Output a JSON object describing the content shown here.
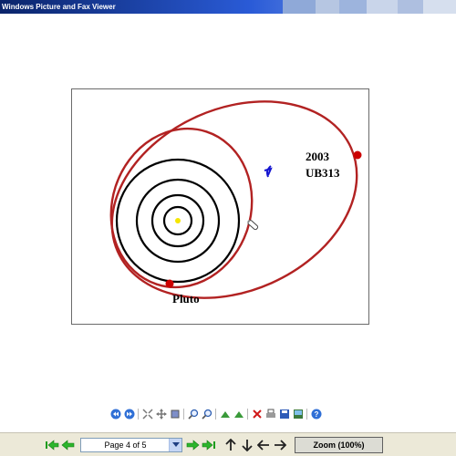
{
  "window": {
    "title": "Windows Picture and Fax Viewer"
  },
  "image": {
    "labels": {
      "object_2003": "2003",
      "object_ub313": "UB313",
      "pluto": "Pluto"
    }
  },
  "toolbar": {
    "icons": [
      "previous-image-icon",
      "next-image-icon",
      "best-fit-icon",
      "actual-size-icon",
      "slideshow-icon",
      "zoom-in-icon",
      "zoom-out-icon",
      "rotate-clockwise-icon",
      "rotate-counterclockwise-icon",
      "delete-icon",
      "print-icon",
      "save-icon",
      "edit-icon",
      "help-icon"
    ]
  },
  "navigation": {
    "page_display": "Page 4 of 5",
    "zoom_label": "Zoom (100%)"
  },
  "colors": {
    "orbit_red": "#b22222",
    "orbit_black": "#000000",
    "sun": "#f5e600",
    "title_bar": "#0a246a"
  }
}
